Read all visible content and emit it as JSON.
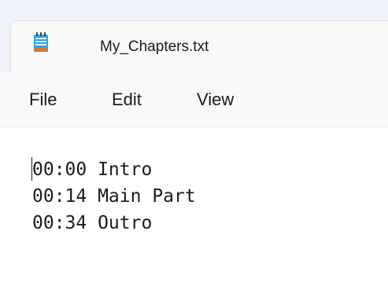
{
  "window": {
    "tab_title": "My_Chapters.txt",
    "app_icon": "notepad-icon"
  },
  "menu": {
    "items": [
      {
        "label": "File"
      },
      {
        "label": "Edit"
      },
      {
        "label": "View"
      }
    ]
  },
  "editor": {
    "lines": [
      "00:00 Intro",
      "00:14 Main Part",
      "00:34 Outro"
    ]
  },
  "colors": {
    "tabbar_background": "#eef1f7",
    "tab_background": "#f9f9f9",
    "editor_background": "#ffffff",
    "text": "#1b1b1b"
  }
}
